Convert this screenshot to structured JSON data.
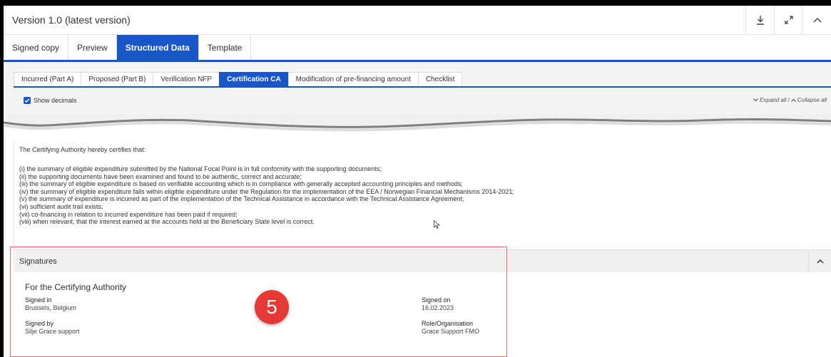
{
  "version": {
    "title": "Version 1.0 (latest version)"
  },
  "main_tabs": [
    {
      "label": "Signed copy"
    },
    {
      "label": "Preview"
    },
    {
      "label": "Structured Data"
    },
    {
      "label": "Template"
    }
  ],
  "sub_tabs": [
    {
      "label": "Incurred (Part A)"
    },
    {
      "label": "Proposed (Part B)"
    },
    {
      "label": "Verification NFP"
    },
    {
      "label": "Certification CA"
    },
    {
      "label": "Modification of pre-financing amount"
    },
    {
      "label": "Checklist"
    }
  ],
  "options": {
    "show_decimals": "Show decimals",
    "expand_all": "Expand all",
    "separator": "/",
    "collapse_all": "Collapse all"
  },
  "cert": {
    "intro": "The Certifying Authority hereby certifies that:",
    "items": [
      "(i) the summary of eligible expenditure submitted by the National Focal Point is in full conformity with the supporting documents;",
      "(ii) the supporting documents have been examined and found to be authentic, correct and accurate;",
      "(iii) the summary of eligible expenditure is based on verifiable accounting which is in compliance with generally accepted accounting principles and methods;",
      "(iv) the summary of eligible expenditure falls within eligible expenditure under the Regulation for the implementation of the EEA / Norwegian Financial Mechanisms 2014-2021;",
      "(v) the summary of expenditure is incurred as part of the implementation of the Technical Assistance in accordance with the Technical Assistance Agreement;",
      "(vi) sufficient audit trail exists;",
      "(vii) co-financing in relation to incurred expenditure has been paid if required;",
      "(viii) when relevant, that the interest earned at the accounts held at the Beneficiary State level is correct."
    ]
  },
  "signatures": {
    "title": "Signatures",
    "for_label": "For the Certifying Authority",
    "signed_in_label": "Signed in",
    "signed_in_value": "Brussels, Belgium",
    "signed_by_label": "Signed by",
    "signed_by_value": "Silje Grace support",
    "signed_on_label": "Signed on",
    "signed_on_value": "16.02.2023",
    "role_label": "Role/Organisation",
    "role_value": "Grace Support FMO"
  },
  "annotation": {
    "step": "5"
  },
  "colors": {
    "accent": "#1856c9",
    "badge": "#e53935",
    "highlight": "#e26a6a"
  }
}
